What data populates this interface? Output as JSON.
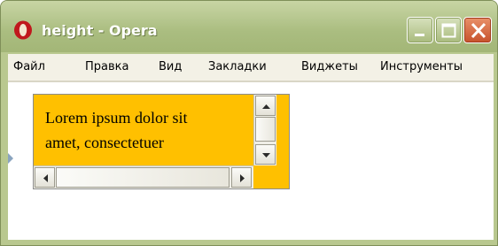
{
  "window": {
    "title": "height - Opera",
    "controls": [
      "minimize-icon",
      "maximize-icon",
      "close-icon"
    ]
  },
  "menu": {
    "items": [
      {
        "label": "Файл"
      },
      {
        "label": "Правка"
      },
      {
        "label": "Вид"
      },
      {
        "label": "Закладки"
      },
      {
        "label": "Виджеты"
      },
      {
        "label": "Инструменты"
      }
    ]
  },
  "content": {
    "box_text": "Lorem ipsum dolor sit\namet, consectetuer",
    "box_color": "#ffc000"
  },
  "colors": {
    "titlebar": "#aabd80",
    "close_button": "#c7512b",
    "opera_logo": "#c0181d"
  }
}
